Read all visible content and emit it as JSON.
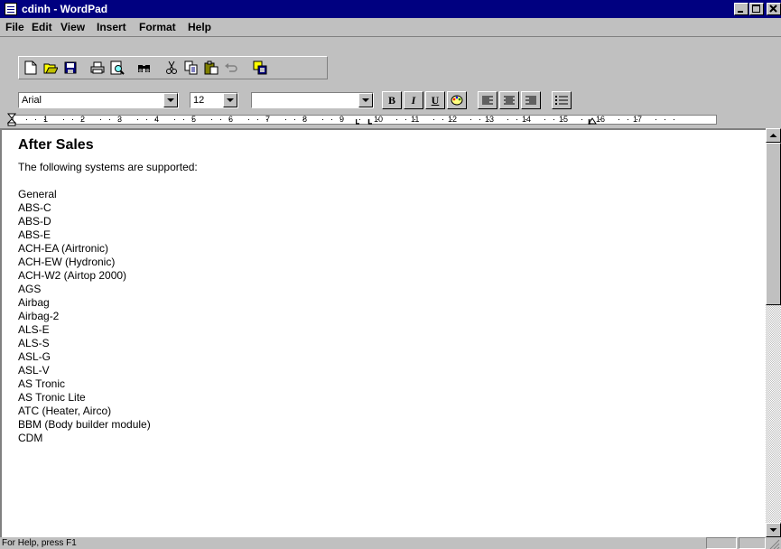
{
  "window": {
    "title": "cdinh - WordPad"
  },
  "menu": [
    "File",
    "Edit",
    "View",
    "Insert",
    "Format",
    "Help"
  ],
  "toolbar": {
    "buttons": [
      "new-icon",
      "open-icon",
      "save-icon",
      "print-icon",
      "print-preview-icon",
      "find-icon",
      "cut-icon",
      "copy-icon",
      "paste-icon",
      "undo-icon",
      "insert-object-icon"
    ]
  },
  "format": {
    "font": "Arial",
    "size": "12",
    "script": "",
    "bold": "B",
    "italic": "I",
    "underline": "U"
  },
  "ruler": {
    "numbers": [
      "1",
      "2",
      "3",
      "4",
      "5",
      "6",
      "7",
      "8",
      "9",
      "10",
      "11",
      "12",
      "13",
      "14",
      "15",
      "16",
      "17"
    ]
  },
  "document": {
    "heading": "After Sales",
    "intro": "The following systems are supported:",
    "items": [
      "General",
      "ABS-C",
      "ABS-D",
      "ABS-E",
      "ACH-EA (Airtronic)",
      "ACH-EW (Hydronic)",
      "ACH-W2 (Airtop 2000)",
      "AGS",
      "Airbag",
      "Airbag-2",
      "ALS-E",
      "ALS-S",
      "ASL-G",
      "ASL-V",
      "AS Tronic",
      "AS Tronic Lite",
      "ATC (Heater, Airco)",
      "BBM (Body builder module)",
      "CDM"
    ]
  },
  "status": {
    "text": "For Help, press F1"
  }
}
